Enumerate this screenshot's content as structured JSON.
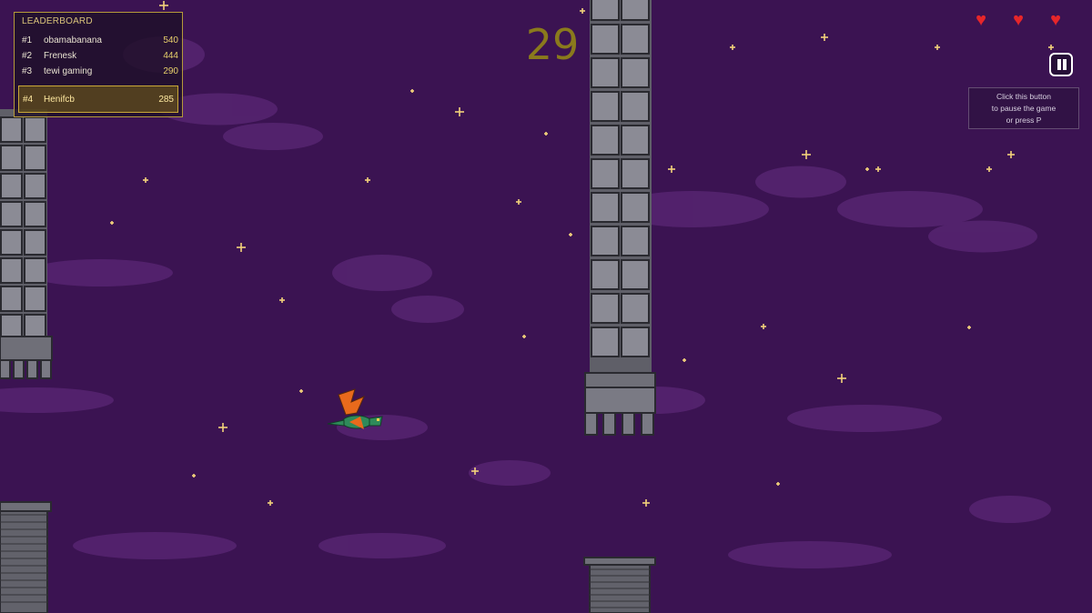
{
  "leaderboard": {
    "title": "LEADERBOARD",
    "entries": [
      {
        "rank": "#1",
        "name": "obamabanana",
        "score": "540"
      },
      {
        "rank": "#2",
        "name": "Frenesk",
        "score": "444"
      },
      {
        "rank": "#3",
        "name": "tewi gaming",
        "score": "290"
      }
    ],
    "you": {
      "rank": "#4",
      "name": "Henifcb",
      "score": "285"
    }
  },
  "hud": {
    "score": "29",
    "lives": 3,
    "pause_hint": [
      "Click this button",
      "to pause the game",
      "or press P"
    ]
  },
  "colors": {
    "sky": "#3b1352",
    "cloud": "#5a2a78",
    "star": "#f2d27a",
    "tower": "#6f6f78",
    "accent": "#c9a838",
    "heart": "#e6262a"
  }
}
